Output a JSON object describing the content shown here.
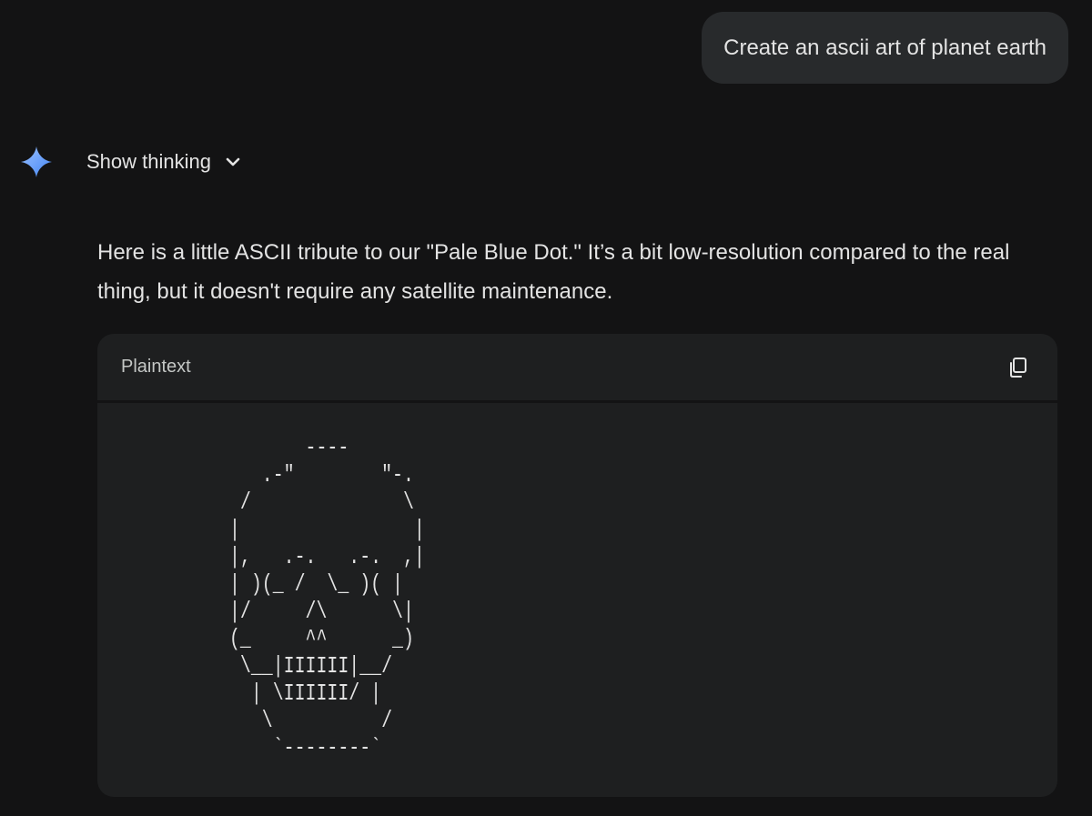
{
  "user_message": {
    "text": "Create an ascii art of planet earth"
  },
  "assistant": {
    "show_thinking_label": "Show thinking",
    "icons": {
      "logo": "gemini-sparkle-icon",
      "toggle": "chevron-down-icon"
    },
    "response_text": "Here is a little ASCII tribute to our \"Pale Blue Dot.\" It’s a bit low-resolution compared to the real thing, but it doesn't require any satellite maintenance.",
    "code_block": {
      "language": "Plaintext",
      "copy_icon": "copy-icon",
      "content": "       ----\n   .-\"        \"-.\n /              \\\n|                |\n|,   .-.   .-.  ,|\n| )(_ /  \\_ )( |\n|/     /\\      \\|\n(_     ^^      _)\n \\__|IIIIII|__/\n  | \\IIIIII/ |\n   \\          /\n    `--------`"
    }
  },
  "colors": {
    "background": "#131314",
    "bubble": "#282a2c",
    "code_block": "#1e1f20",
    "text": "#e3e3e3",
    "gem_gradient_start": "#4285f4",
    "gem_gradient_end": "#9bc1ff"
  }
}
